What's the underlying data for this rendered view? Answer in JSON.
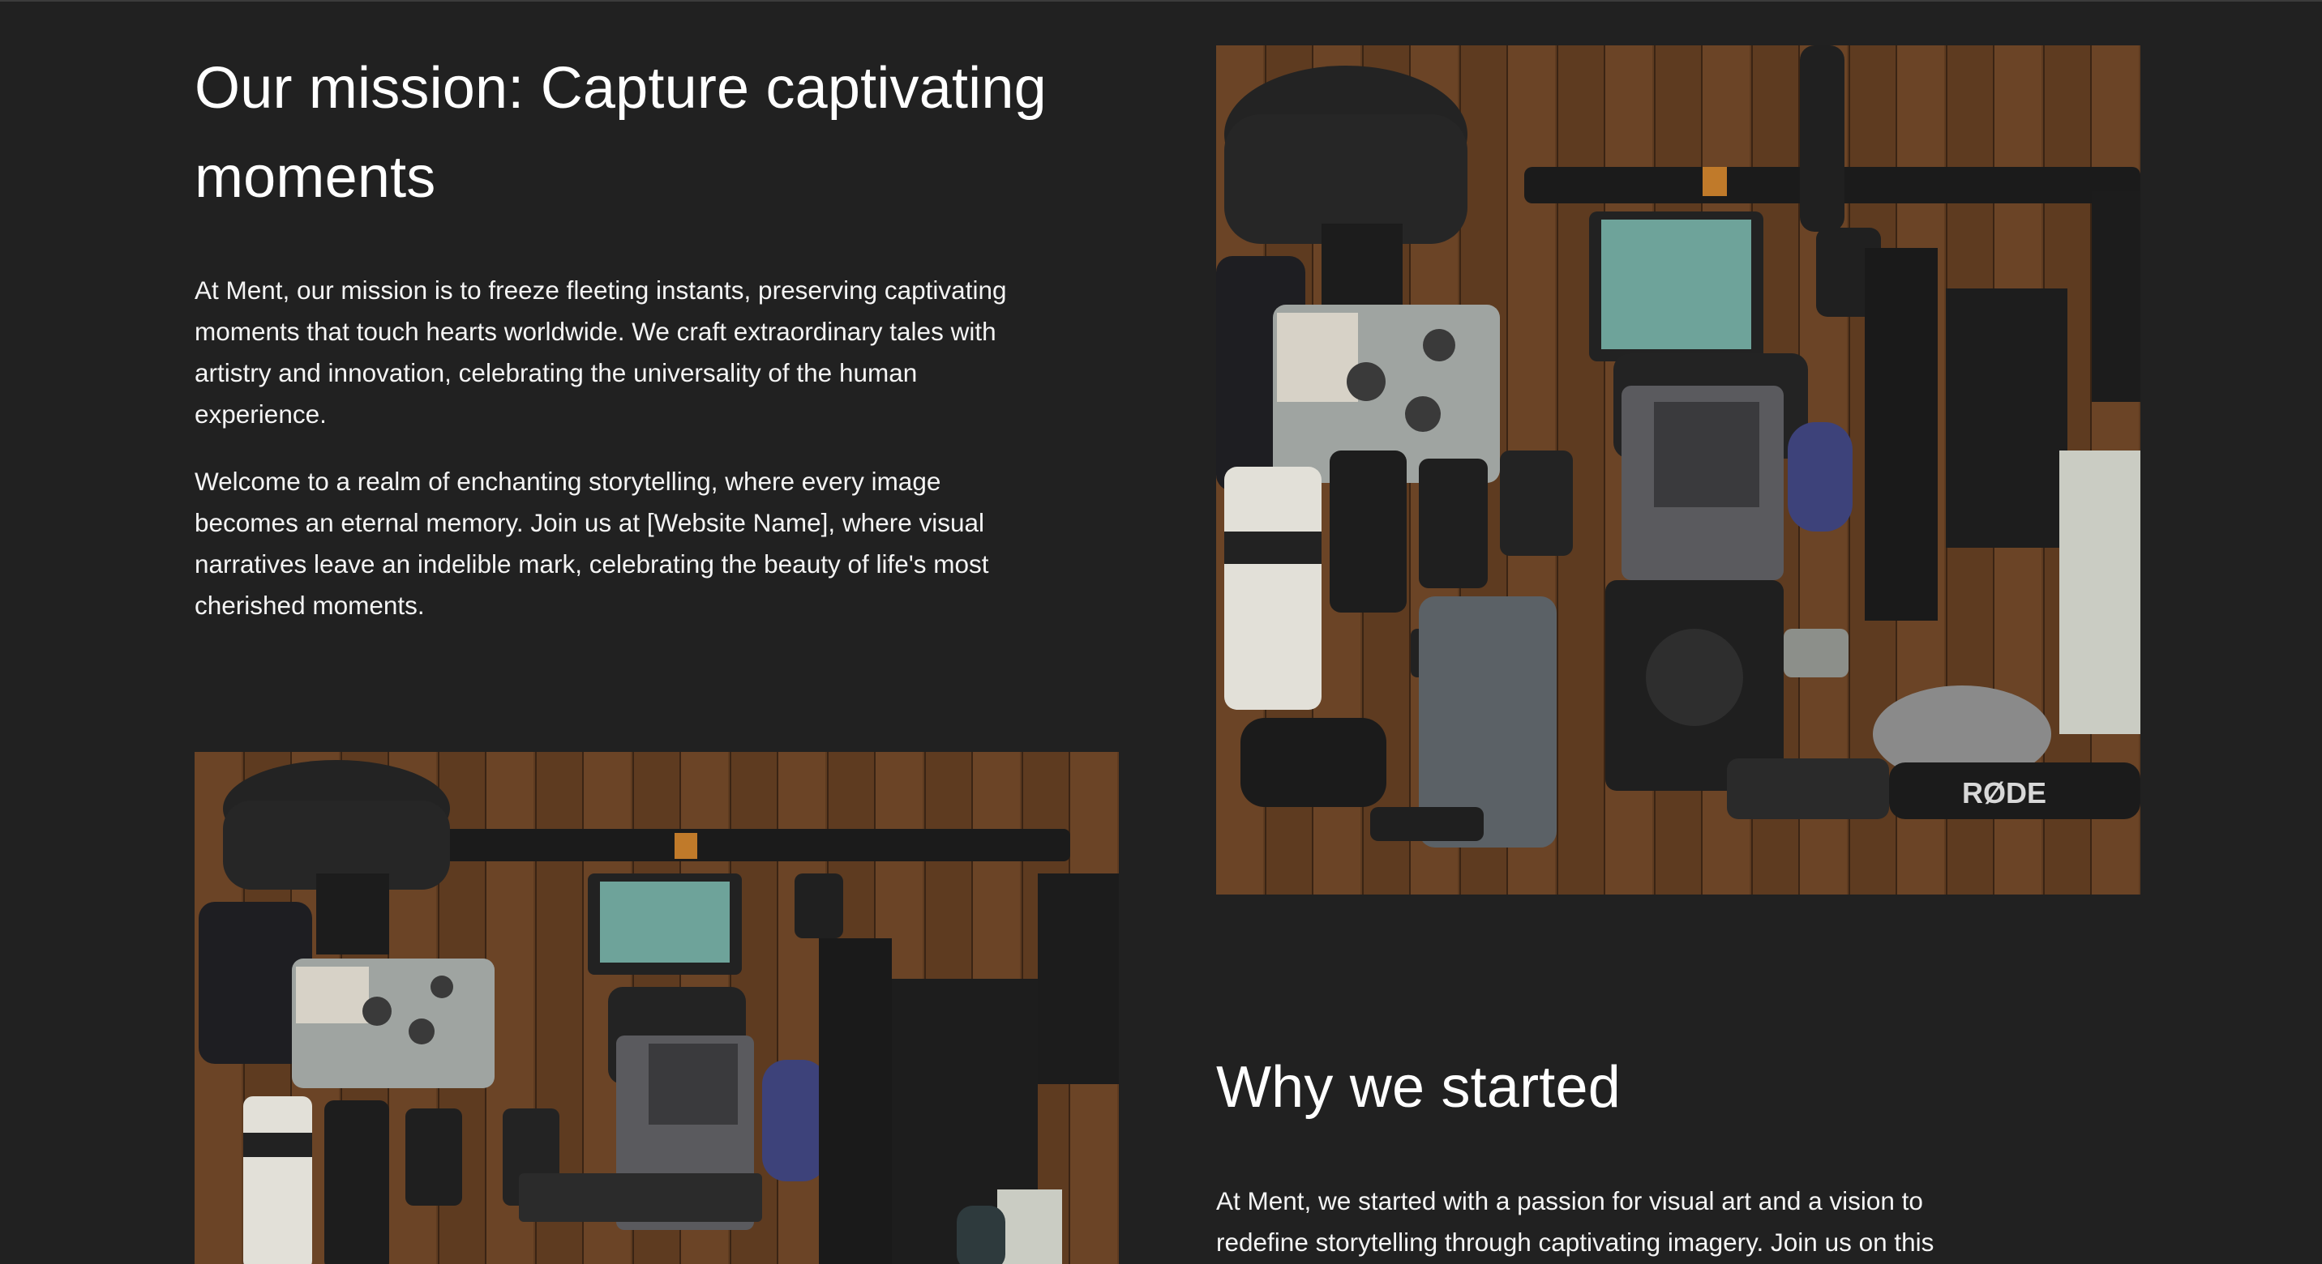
{
  "mission": {
    "heading": "Our mission: Capture captivating moments",
    "paragraph_1": "At Ment, our mission is to freeze fleeting instants, preserving captivating moments that touch hearts worldwide. We craft extraordinary tales with artistry and innovation, celebrating the universality of the human experience.",
    "paragraph_2": "Welcome to a realm of enchanting storytelling, where every image becomes an eternal memory. Join us at [Website Name], where visual narratives leave an indelible mark, celebrating the beauty of life's most cherished moments."
  },
  "why": {
    "heading": "Why we started",
    "paragraph_1": "At Ment, we started with a passion for visual art and a vision to redefine storytelling through captivating imagery. Join us on this"
  },
  "images": {
    "gear_photo_brand_text": "RØDE"
  },
  "colors": {
    "background": "#212121",
    "text": "#ffffff",
    "wood": "#6b4426"
  }
}
